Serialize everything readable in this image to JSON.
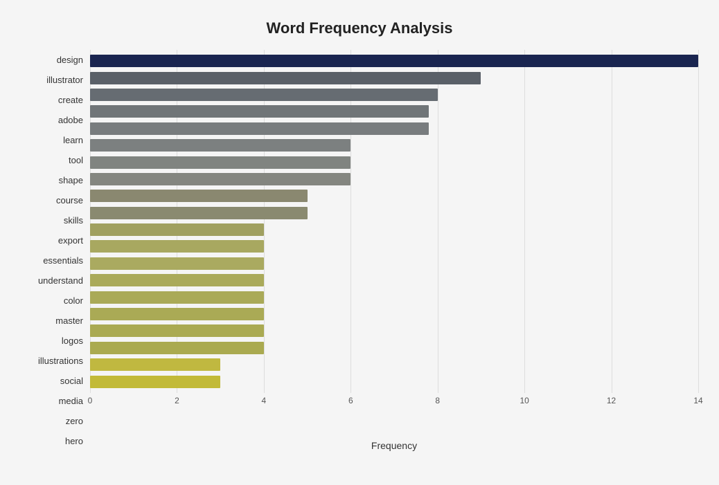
{
  "title": "Word Frequency Analysis",
  "x_axis_label": "Frequency",
  "max_value": 14,
  "x_ticks": [
    0,
    2,
    4,
    6,
    8,
    10,
    12,
    14
  ],
  "bars": [
    {
      "label": "design",
      "value": 14,
      "color": "#1a2550"
    },
    {
      "label": "illustrator",
      "value": 9,
      "color": "#5a6068"
    },
    {
      "label": "create",
      "value": 8,
      "color": "#666c72"
    },
    {
      "label": "adobe",
      "value": 7.8,
      "color": "#707578"
    },
    {
      "label": "learn",
      "value": 7.8,
      "color": "#787c7e"
    },
    {
      "label": "tool",
      "value": 6,
      "color": "#7c8080"
    },
    {
      "label": "shape",
      "value": 6,
      "color": "#808480"
    },
    {
      "label": "course",
      "value": 6,
      "color": "#848680"
    },
    {
      "label": "skills",
      "value": 5,
      "color": "#8a8870"
    },
    {
      "label": "export",
      "value": 5,
      "color": "#8a8a70"
    },
    {
      "label": "essentials",
      "value": 4,
      "color": "#a0a060"
    },
    {
      "label": "understand",
      "value": 4,
      "color": "#a8a860"
    },
    {
      "label": "color",
      "value": 4,
      "color": "#aaaa60"
    },
    {
      "label": "master",
      "value": 4,
      "color": "#aaaa5a"
    },
    {
      "label": "logos",
      "value": 4,
      "color": "#aaaa58"
    },
    {
      "label": "illustrations",
      "value": 4,
      "color": "#aaaa55"
    },
    {
      "label": "social",
      "value": 4,
      "color": "#aaaa52"
    },
    {
      "label": "media",
      "value": 4,
      "color": "#aaaa50"
    },
    {
      "label": "zero",
      "value": 3,
      "color": "#c0b840"
    },
    {
      "label": "hero",
      "value": 3,
      "color": "#c2ba38"
    }
  ],
  "colors": {
    "background": "#f5f5f5",
    "grid": "#dddddd"
  }
}
